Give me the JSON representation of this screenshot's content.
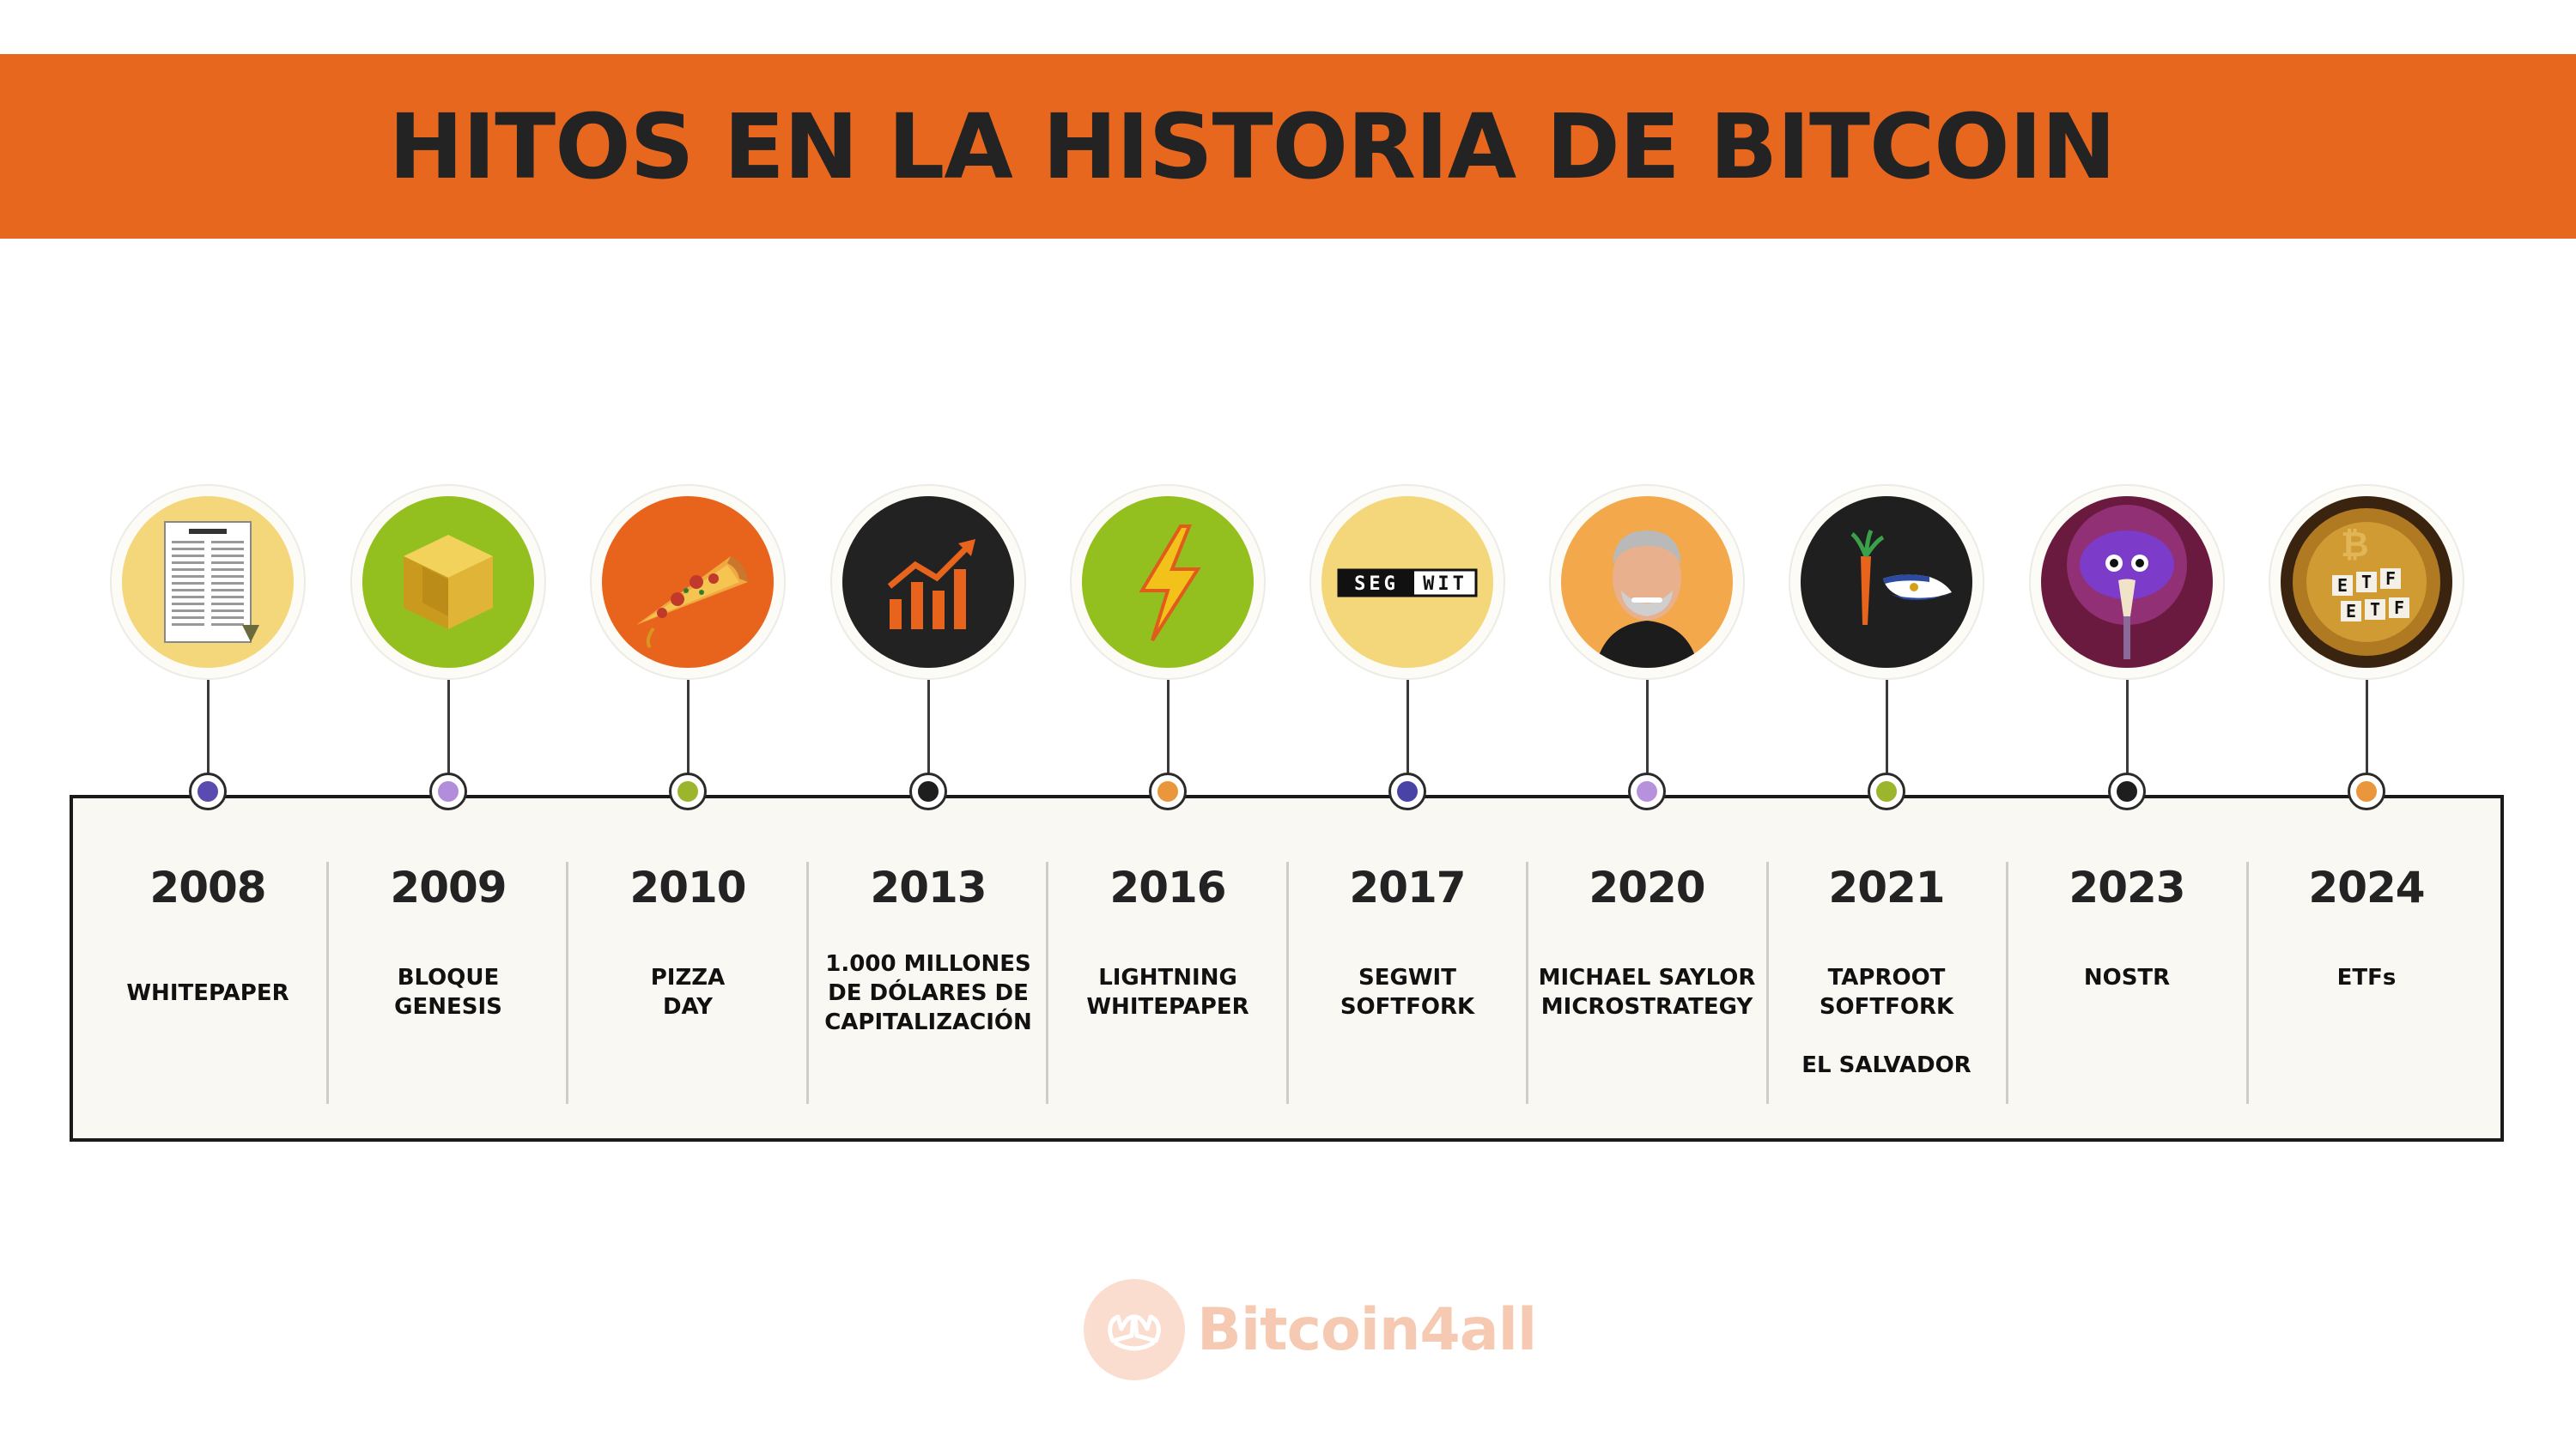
{
  "title": "HITOS EN LA HISTORIA DE BITCOIN",
  "colors": {
    "banner": "#e8671f",
    "panel": "#faf8f3"
  },
  "milestones": [
    {
      "year": "2008",
      "label": "WHITEPAPER",
      "icon": "whitepaper-document-icon",
      "dot": "#5a4bb0"
    },
    {
      "year": "2009",
      "label": "BLOQUE\nGENESIS",
      "icon": "gold-cube-icon",
      "dot": "#b28ddb"
    },
    {
      "year": "2010",
      "label": "PIZZA\nDAY",
      "icon": "pizza-slice-icon",
      "dot": "#9bb52c"
    },
    {
      "year": "2013",
      "label": "1.000 MILLONES\nDE DÓLARES DE\nCAPITALIZACIÓN",
      "icon": "chart-growth-icon",
      "dot": "#1e1e1e"
    },
    {
      "year": "2016",
      "label": "LIGHTNING\nWHITEPAPER",
      "icon": "lightning-bolt-icon",
      "dot": "#e9963c"
    },
    {
      "year": "2017",
      "label": "SEGWIT\nSOFTFORK",
      "icon": "segwit-logo-icon",
      "dot": "#4a43a6"
    },
    {
      "year": "2020",
      "label": "MICHAEL SAYLOR\nMICROSTRATEGY",
      "icon": "michael-saylor-portrait-icon",
      "dot": "#b692dc"
    },
    {
      "year": "2021",
      "label": "TAPROOT\nSOFTFORK\n\nEL SALVADOR",
      "icon": "taproot-el-salvador-icon",
      "dot": "#9bb52c"
    },
    {
      "year": "2023",
      "label": "NOSTR",
      "icon": "nostr-ostrich-icon",
      "dot": "#1e1e1e"
    },
    {
      "year": "2024",
      "label": "ETFs",
      "icon": "etf-bitcoin-coin-icon",
      "dot": "#e9963c"
    }
  ],
  "brand": {
    "name": "Bitcoin4all",
    "icon": "hands-logo-icon"
  }
}
